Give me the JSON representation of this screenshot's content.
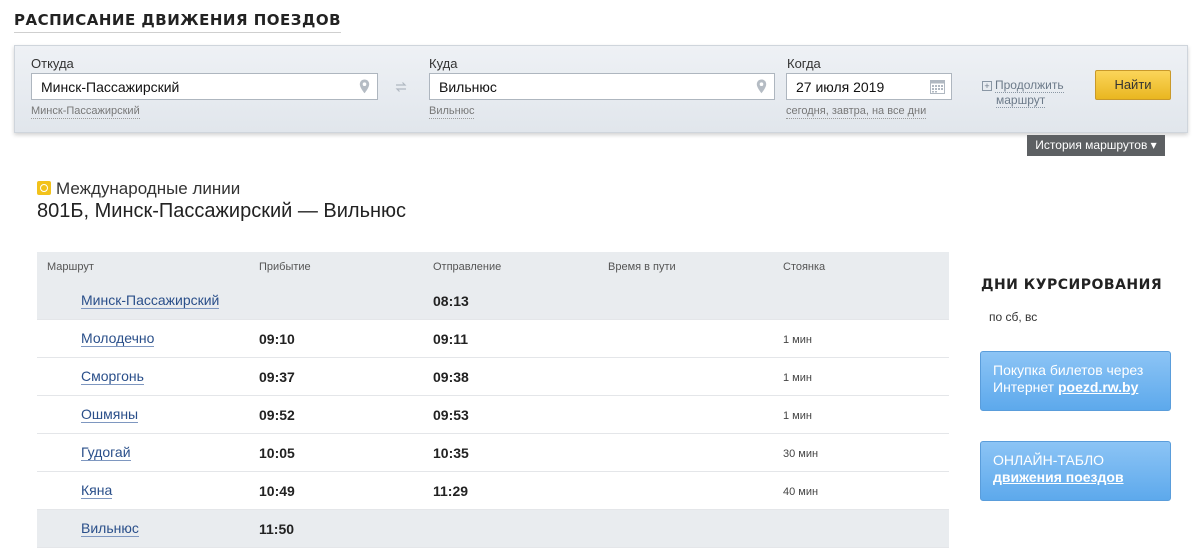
{
  "page": {
    "title": "Расписание движения поездов"
  },
  "search": {
    "from_label": "Откуда",
    "from_value": "Минск-Пассажирский",
    "from_hint": "Минск-Пассажирский",
    "to_label": "Куда",
    "to_value": "Вильнюс",
    "to_hint": "Вильнюс",
    "when_label": "Когда",
    "when_value": "27 июля 2019",
    "when_hint": "сегодня, завтра, на все дни",
    "continue_line1": "Продолжить",
    "continue_line2": "маршрут",
    "find_label": "Найти",
    "history_label": "История маршрутов ▾"
  },
  "train": {
    "category": "Международные линии",
    "title": "801Б, Минск-Пассажирский — Вильнюс"
  },
  "timetable": {
    "headers": [
      "Маршрут",
      "Прибытие",
      "Отправление",
      "Время в пути",
      "Стоянка"
    ],
    "rows": [
      {
        "station": "Минск-Пассажирский",
        "arrival": "",
        "departure": "08:13",
        "travel": "",
        "stop": ""
      },
      {
        "station": "Молодечно",
        "arrival": "09:10",
        "departure": "09:11",
        "travel": "",
        "stop": "1 мин"
      },
      {
        "station": "Сморгонь",
        "arrival": "09:37",
        "departure": "09:38",
        "travel": "",
        "stop": "1 мин"
      },
      {
        "station": "Ошмяны",
        "arrival": "09:52",
        "departure": "09:53",
        "travel": "",
        "stop": "1 мин"
      },
      {
        "station": "Гудогай",
        "arrival": "10:05",
        "departure": "10:35",
        "travel": "",
        "stop": "30 мин"
      },
      {
        "station": "Кяна",
        "arrival": "10:49",
        "departure": "11:29",
        "travel": "",
        "stop": "40 мин"
      },
      {
        "station": "Вильнюс",
        "arrival": "11:50",
        "departure": "",
        "travel": "",
        "stop": ""
      }
    ]
  },
  "sidebar": {
    "days_title": "Дни курсирования",
    "days_value": "по сб, вс",
    "promo1_line1": "Покупка билетов через",
    "promo1_prefix": "Интернет",
    "promo1_link": "poezd.rw.by",
    "promo2_line1": "ОНЛАЙН-ТАБЛО",
    "promo2_link": "движения поездов"
  },
  "colors": {
    "accent_button": "#f0c22e",
    "link": "#2a4f8a",
    "promo": "#6db2f0",
    "history": "#5d6063"
  }
}
